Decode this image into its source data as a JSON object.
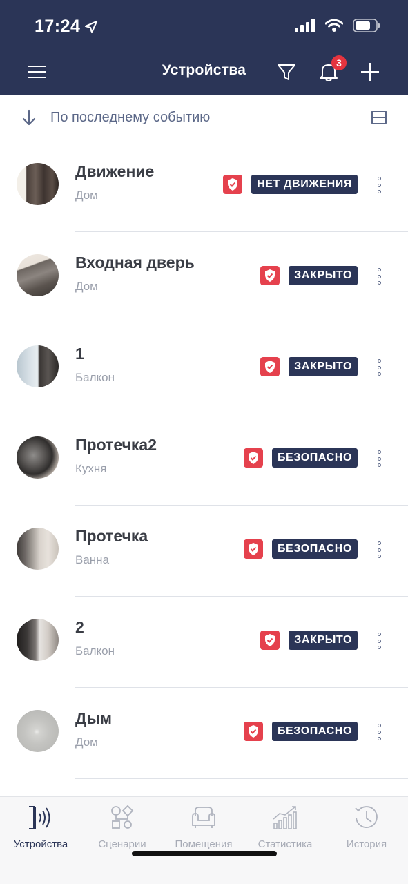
{
  "status_bar": {
    "time": "17:24"
  },
  "header": {
    "title": "Устройства",
    "notifications_count": "3"
  },
  "sort": {
    "label": "По последнему событию"
  },
  "devices": [
    {
      "name": "Движение",
      "room": "Дом",
      "status": "НЕТ ДВИЖЕНИЯ"
    },
    {
      "name": "Входная дверь",
      "room": "Дом",
      "status": "ЗАКРЫТО"
    },
    {
      "name": "1",
      "room": "Балкон",
      "status": "ЗАКРЫТО"
    },
    {
      "name": "Протечка2",
      "room": "Кухня",
      "status": "БЕЗОПАСНО"
    },
    {
      "name": "Протечка",
      "room": "Ванна",
      "status": "БЕЗОПАСНО"
    },
    {
      "name": "2",
      "room": "Балкон",
      "status": "ЗАКРЫТО"
    },
    {
      "name": "Дым",
      "room": "Дом",
      "status": "БЕЗОПАСНО"
    }
  ],
  "tabs": [
    {
      "label": "Устройства",
      "icon": "devices-icon",
      "active": true
    },
    {
      "label": "Сценарии",
      "icon": "scenarios-icon",
      "active": false
    },
    {
      "label": "Помещения",
      "icon": "rooms-icon",
      "active": false
    },
    {
      "label": "Статистика",
      "icon": "statistics-icon",
      "active": false
    },
    {
      "label": "История",
      "icon": "history-icon",
      "active": false
    }
  ],
  "colors": {
    "header_bg": "#2b3557",
    "shield": "#e5414d",
    "badge": "#e5343f"
  }
}
